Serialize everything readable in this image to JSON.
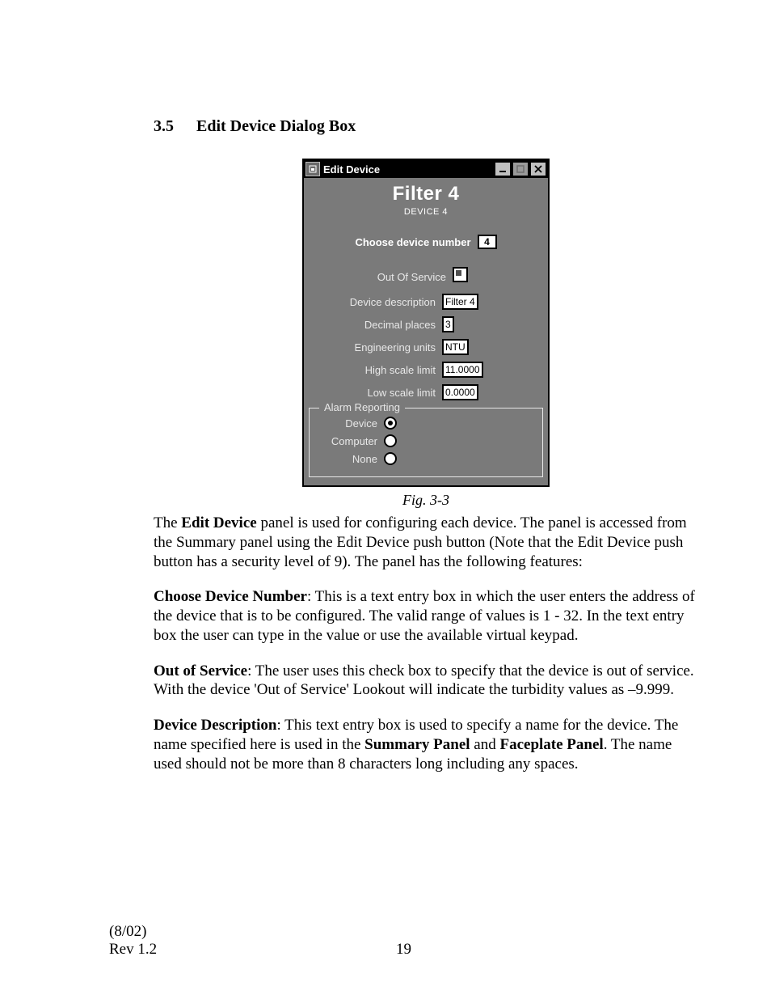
{
  "section": {
    "number": "3.5",
    "title": "Edit Device Dialog Box"
  },
  "dialog": {
    "window_title": "Edit Device",
    "heading": "Filter 4",
    "subheading": "DEVICE 4",
    "choose_label": "Choose device number",
    "choose_value": "4",
    "fields": {
      "out_of_service": {
        "label": "Out Of Service",
        "checked": true
      },
      "description": {
        "label": "Device description",
        "value": "Filter 4"
      },
      "decimals": {
        "label": "Decimal places",
        "value": "3"
      },
      "units": {
        "label": "Engineering units",
        "value": "NTU"
      },
      "high": {
        "label": "High scale limit",
        "value": "11.0000"
      },
      "low": {
        "label": "Low scale limit",
        "value": "0.0000"
      }
    },
    "alarm_group": {
      "legend": "Alarm Reporting",
      "options": [
        {
          "label": "Device",
          "selected": true
        },
        {
          "label": "Computer",
          "selected": false
        },
        {
          "label": "None",
          "selected": false
        }
      ]
    }
  },
  "figure_caption": "Fig. 3-3",
  "paragraphs": {
    "intro_1": "The ",
    "intro_bold": "Edit Device",
    "intro_2": " panel is used for configuring each device. The panel is accessed from the Summary panel using the Edit Device push button (Note that the Edit Device push button has a security level of 9). The panel has the following features:",
    "p2_bold": "Choose Device Number",
    "p2_rest": ": This is a text entry box in which the user enters the address of the device that is to be configured. The valid range of values is 1 - 32. In the text entry box the user can type in the value or use the available virtual keypad.",
    "p3_bold": "Out of Service",
    "p3_rest": ": The user uses this check box to specify that the device is out of service. With the device 'Out of Service' Lookout will indicate the turbidity values as –9.999.",
    "p4_bold": "Device Description",
    "p4_rest_a": ": This text entry box is used to specify a name for the device. The name specified here is used in the ",
    "p4_bold2": "Summary Panel",
    "p4_mid": " and ",
    "p4_bold3": "Faceplate Panel",
    "p4_rest_b": ". The name used should not be more than 8 characters long including any spaces."
  },
  "footer": {
    "date": "(8/02)",
    "rev": "Rev 1.2",
    "page": "19"
  }
}
